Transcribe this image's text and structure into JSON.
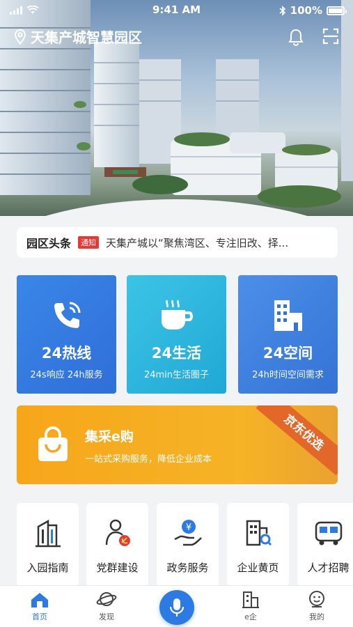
{
  "status_bar": {
    "time": "9:41 AM",
    "battery": "100%"
  },
  "header": {
    "location": "天集产城智慧园区",
    "icons": [
      "bell-icon",
      "scan-icon"
    ]
  },
  "headline": {
    "title": "园区头条",
    "tag": "通知",
    "text": "天集产城以“聚焦湾区、专注旧改、择..."
  },
  "cards": [
    {
      "title": "24热线",
      "subtitle": "24s响应 24h服务",
      "icon": "phone-icon",
      "color": "#3a86e8"
    },
    {
      "title": "24生活",
      "subtitle": "24min生活圈子",
      "icon": "coffee-cup-icon",
      "color": "#3cc4e6"
    },
    {
      "title": "24空间",
      "subtitle": "24h时间空间需求",
      "icon": "building-icon",
      "color": "#4c8fe8"
    }
  ],
  "jd_banner": {
    "title": "集采e购",
    "subtitle": "一站式采购服务，降低企业成本",
    "ribbon": "京东优选",
    "icon": "shopping-bag-icon",
    "color": "#f7a61a"
  },
  "services": [
    {
      "label": "入园指南",
      "icon": "office-building-icon"
    },
    {
      "label": "党群建设",
      "icon": "party-member-icon"
    },
    {
      "label": "政务服务",
      "icon": "government-service-icon"
    },
    {
      "label": "企业黄页",
      "icon": "enterprise-directory-icon"
    },
    {
      "label": "人才招聘",
      "icon": "bus-icon"
    }
  ],
  "tabbar": {
    "active_color": "#2c7be5",
    "items": [
      {
        "label": "首页",
        "icon": "home-icon"
      },
      {
        "label": "发现",
        "icon": "planet-icon"
      },
      {
        "label": "",
        "icon": "microphone-icon"
      },
      {
        "label": "e企",
        "icon": "enterprise-icon"
      },
      {
        "label": "我的",
        "icon": "profile-icon"
      }
    ]
  }
}
